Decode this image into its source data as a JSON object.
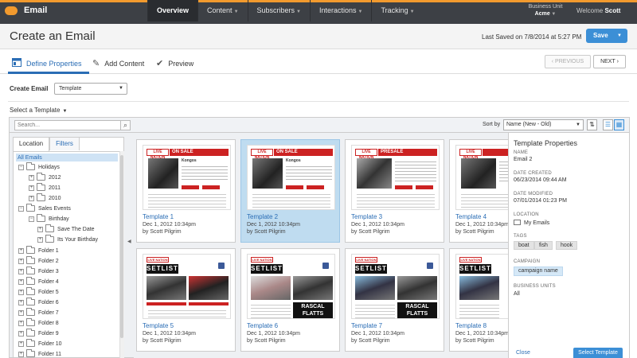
{
  "topbar": {
    "app_name": "Email",
    "nav": [
      {
        "label": "Overview",
        "active": true,
        "has_menu": false
      },
      {
        "label": "Content",
        "active": false,
        "has_menu": true
      },
      {
        "label": "Subscribers",
        "active": false,
        "has_menu": true
      },
      {
        "label": "Interactions",
        "active": false,
        "has_menu": true
      },
      {
        "label": "Tracking",
        "active": false,
        "has_menu": true
      }
    ],
    "business_unit_label": "Business Unit",
    "business_unit_value": "Acme",
    "welcome_label": "Welcome",
    "user_name": "Scott",
    "accent_color": "#f29a2e"
  },
  "header": {
    "title": "Create an Email",
    "last_saved": "Last Saved on 7/8/2014 at 5:27 PM",
    "save_label": "Save"
  },
  "steps": {
    "items": [
      "Define Properties",
      "Add Content",
      "Preview"
    ],
    "active": 0,
    "prev_label": "PREVIOUS",
    "next_label": "NEXT"
  },
  "create_email": {
    "label": "Create Email",
    "value": "Template"
  },
  "select_template_label": "Select a Template",
  "toolbar": {
    "search_placeholder": "Search...",
    "sort_label": "Sort by",
    "sort_value": "Name (New - Old)"
  },
  "left_panel": {
    "tabs": [
      "Location",
      "Filters"
    ],
    "tree": {
      "all": "All Emails",
      "holidays": "Holidays",
      "y2012": "2012",
      "y2011": "2011",
      "y2010": "2010",
      "sales_events": "Sales Events",
      "birthday": "Birthday",
      "save_the_date": "Save The Date",
      "its_your_birthday": "Its Your Birthday",
      "folder1": "Folder 1",
      "folder2": "Folder 2",
      "folder3": "Folder 3",
      "folder4": "Folder 4",
      "folder5": "Folder 5",
      "folder6": "Folder 6",
      "folder7": "Folder 7",
      "folder8": "Folder 8",
      "folder9": "Folder 9",
      "folder10": "Folder 10",
      "folder11": "Folder 11"
    }
  },
  "templates": [
    {
      "name": "Template 1",
      "date": "Dec 1, 2012 10:34pm",
      "by": "by Scott Pilgrim",
      "banner": "ON SALE",
      "logo": "LIVE NATION",
      "selected": false
    },
    {
      "name": "Template 2",
      "date": "Dec 1, 2012 10:34pm",
      "by": "by Scott Pilgrim",
      "banner": "ON SALE",
      "logo": "LIVE NATION",
      "selected": true
    },
    {
      "name": "Template 3",
      "date": "Dec 1, 2012 10:34pm",
      "by": "by Scott Pilgrim",
      "banner": "PRESALE",
      "logo": "LIVE NATION",
      "selected": false
    },
    {
      "name": "Template 4",
      "date": "Dec 1, 2012 10:34pm",
      "by": "by Scott Pilgrim",
      "banner": "",
      "logo": "LIVE NATION",
      "selected": false
    },
    {
      "name": "Template 5",
      "date": "Dec 1, 2012 10:34pm",
      "by": "by Scott Pilgrim",
      "banner": "SETLIST",
      "logo": "LIVE NATION",
      "selected": false
    },
    {
      "name": "Template 6",
      "date": "Dec 1, 2012 10:34pm",
      "by": "by Scott Pilgrim",
      "banner": "SETLIST",
      "logo": "LIVE NATION",
      "selected": false
    },
    {
      "name": "Template 7",
      "date": "Dec 1, 2012 10:34pm",
      "by": "by Scott Pilgrim",
      "banner": "SETLIST",
      "logo": "LIVE NATION",
      "selected": false
    },
    {
      "name": "Template 8",
      "date": "Dec 1, 2012 10:34pm",
      "by": "by Scott Pilgrim",
      "banner": "SETLIST",
      "logo": "LIVE NATION",
      "selected": false
    }
  ],
  "thumbs": {
    "on_sale_artist": "Kongos",
    "rascal": "RASCAL",
    "flatts": "FLATTS"
  },
  "properties": {
    "title": "Template Properties",
    "name_label": "NAME",
    "name_value": "Email 2",
    "created_label": "DATE CREATED",
    "created_value": "06/23/2014 09:44 AM",
    "modified_label": "DATE MODIFIED",
    "modified_value": "07/01/2014 01:23 PM",
    "location_label": "LOCATION",
    "location_value": "My Emails",
    "tags_label": "TAGS",
    "tags": [
      "boat",
      "fish",
      "hook"
    ],
    "campaign_label": "CAMPAIGN",
    "campaign_value": "campaign name",
    "bu_label": "BUSINESS UNITS",
    "bu_value": "All",
    "close_label": "Close",
    "select_label": "Select Template"
  },
  "icons": {
    "logo": "cloud-icon",
    "define": "layout-icon",
    "add_content": "pencil-icon",
    "preview": "check-icon",
    "search": "search-icon",
    "sort_direction": "sort-icon",
    "view_list": "list-view-icon",
    "view_grid": "grid-view-icon"
  },
  "colors": {
    "primary": "#3c8fd6",
    "link": "#2a6db5",
    "selected_card": "#bfdcf0",
    "live_nation_red": "#cc2222"
  }
}
